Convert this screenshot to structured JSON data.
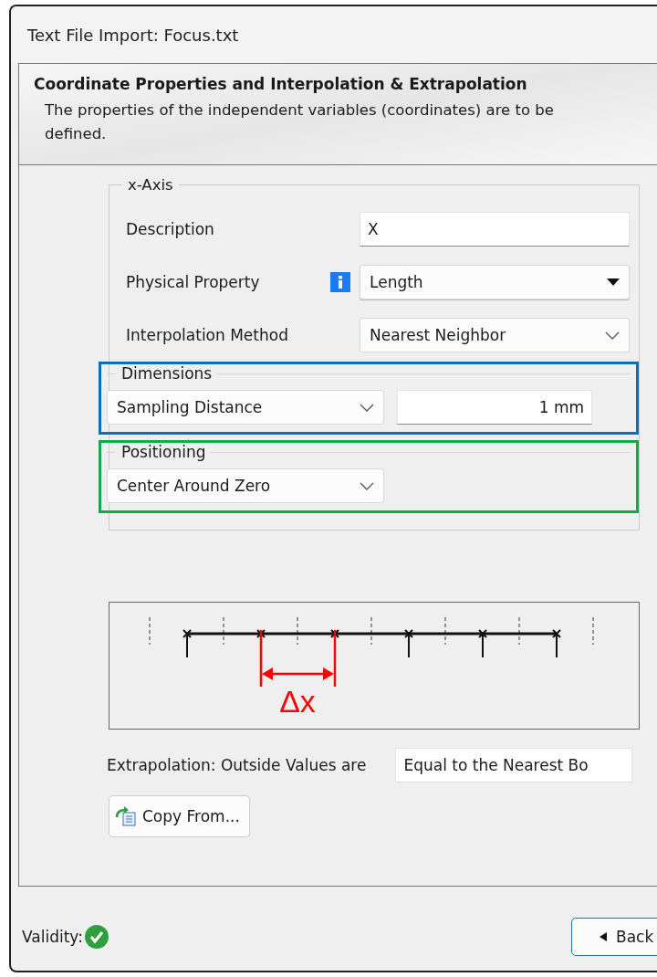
{
  "window": {
    "title": "Text File Import: Focus.txt"
  },
  "header": {
    "title": "Coordinate Properties and Interpolation & Extrapolation",
    "description_lines": [
      "The properties of the independent variables (coordinates) are to be",
      "defined."
    ]
  },
  "axis_group": {
    "title": "x-Axis",
    "description": {
      "label": "Description",
      "value": "X"
    },
    "physical_property": {
      "label": "Physical Property",
      "value": "Length"
    },
    "interpolation": {
      "label": "Interpolation Method",
      "value": "Nearest Neighbor"
    },
    "dimensions": {
      "title": "Dimensions",
      "mode": "Sampling Distance",
      "value": "1 mm",
      "color": "#0a6ebd"
    },
    "positioning": {
      "title": "Positioning",
      "mode": "Center Around Zero",
      "color": "#13a84a"
    }
  },
  "diagram": {
    "delta_label": "Δx"
  },
  "extrapolation": {
    "label": "Extrapolation: Outside Values are",
    "value": "Equal to the Nearest Bo"
  },
  "copy_button": "Copy From...",
  "footer": {
    "validity_label": "Validity:",
    "valid": true,
    "back_button": "Back"
  }
}
